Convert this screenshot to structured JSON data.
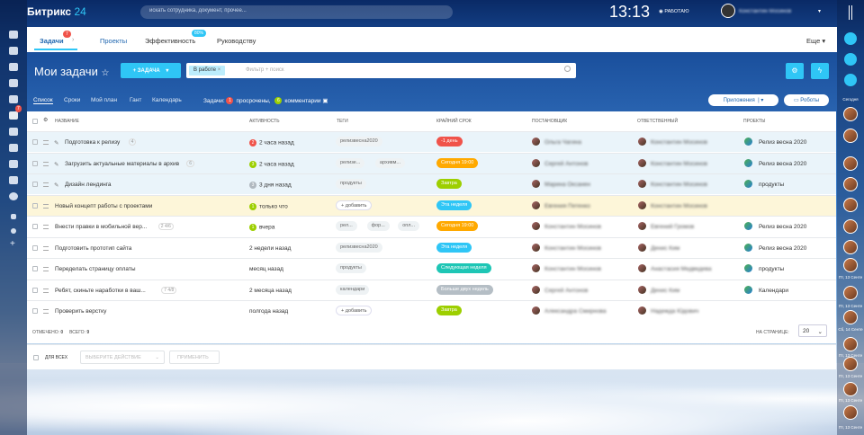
{
  "app": {
    "logo_a": "Битрикс",
    "logo_b": "24",
    "search_placeholder": "искать сотрудника, документ, прочее...",
    "clock": "13:13",
    "work_status": "РАБОТАЮ",
    "user_name": "Константин Мосинов"
  },
  "sidebar": {
    "badge": "7"
  },
  "right": {
    "today": "Сегодня",
    "d1": "Пт, 13 Сенте",
    "d2": "Пт, 13 Сенте",
    "d3": "Пт, 13 Сенте",
    "d4": "Сб, 14 Сенте",
    "d5": "Пт, 13 Сенте",
    "d6": "Пт, 13 Сенте",
    "d7": "Пт, 13 Сенте"
  },
  "nav": {
    "tasks": "Задачи",
    "tasks_badge": "7",
    "projects": "Проекты",
    "efficiency": "Эффективность",
    "eff_badge": "80%",
    "leadership": "Руководству",
    "more": "Еще"
  },
  "header": {
    "title": "Мои задачи",
    "add_button": "+ ЗАДАЧА",
    "filter_chip": "В работе",
    "filter_placeholder": "Фильтр + поиск"
  },
  "views": {
    "list": "Список",
    "deadlines": "Сроки",
    "plan": "Мой план",
    "gantt": "Гант",
    "calendar": "Календарь",
    "tasks_label": "Задачи:",
    "overdue_count": "1",
    "overdue": "просрочены,",
    "comments_count": "6",
    "comments": "комментарии",
    "apps": "Приложения",
    "robots": "Роботы"
  },
  "columns": {
    "name": "НАЗВАНИЕ",
    "activity": "АКТИВНОСТЬ",
    "tags": "ТЕГИ",
    "deadline": "КРАЙНИЙ СРОК",
    "creator": "ПОСТАНОВЩИК",
    "responsible": "ОТВЕТСТВЕННЫЙ",
    "projects": "ПРОЕКТЫ"
  },
  "rows": [
    {
      "name": "Подготовка к релизу",
      "meta": "4",
      "act_badge": "2",
      "act_color": "#f0534a",
      "activity": "2 часа назад",
      "tags": [
        "релизвесна2020"
      ],
      "deadline": "-1 день",
      "dl_color": "#f0534a",
      "creator": "Ольга Чагина",
      "resp": "Константин Мосинов",
      "project": "Релиз весна 2020",
      "style": "b",
      "pin": true
    },
    {
      "name": "Загрузить актуальные материалы в архив",
      "meta": "6",
      "act_badge": "3",
      "act_color": "#9dcf00",
      "activity": "2 часа назад",
      "tags": [
        "релизе...",
        "архивм..."
      ],
      "deadline": "Сегодня 19:00",
      "dl_color": "#ffa900",
      "creator": "Сергей Антонов",
      "resp": "Константин Мосинов",
      "project": "Релиз весна 2020",
      "style": "b",
      "pin": true
    },
    {
      "name": "Дизайн лендинга",
      "meta": "",
      "act_badge": "3",
      "act_color": "#b0b8bf",
      "activity": "3 дня назад",
      "tags": [
        "продукты"
      ],
      "deadline": "Завтра",
      "dl_color": "#9dcf00",
      "creator": "Марина Оксанен",
      "resp": "Константин Мосинов",
      "project": "продукты",
      "style": "b",
      "pin": true
    },
    {
      "name": "Новый концепт работы с проектами",
      "meta": "",
      "act_badge": "1",
      "act_color": "#9dcf00",
      "activity": "только что",
      "tags": [
        "+ добавить"
      ],
      "deadline": "Эта неделя",
      "dl_color": "#2fc6f6",
      "creator": "Евгения Петенко",
      "resp": "Константин Мосинов",
      "project": "",
      "style": "y",
      "pin": false
    },
    {
      "name": "Внести правки в мобильной вер...",
      "meta": "2  4/6",
      "act_badge": "1",
      "act_color": "#9dcf00",
      "activity": "вчера",
      "tags": [
        "рел...",
        "фор...",
        "опл..."
      ],
      "deadline": "Сегодня 19:00",
      "dl_color": "#ffa900",
      "creator": "Константин Мосинов",
      "resp": "Евгений Громов",
      "project": "Релиз весна 2020",
      "style": "",
      "pin": false
    },
    {
      "name": "Подготовить прототип сайта",
      "meta": "",
      "act_badge": "",
      "act_color": "",
      "activity": "2 недели назад",
      "tags": [
        "релизвесна2020"
      ],
      "deadline": "Эта неделя",
      "dl_color": "#2fc6f6",
      "creator": "Константин Мосинов",
      "resp": "Денис Ким",
      "project": "Релиз весна 2020",
      "style": "",
      "pin": false
    },
    {
      "name": "Переделать страницу оплаты",
      "meta": "",
      "act_badge": "",
      "act_color": "",
      "activity": "месяц назад",
      "tags": [
        "продукты"
      ],
      "deadline": "Следующая неделя",
      "dl_color": "#1ec6b5",
      "creator": "Константин Мосинов",
      "resp": "Анастасия Медведева",
      "project": "продукты",
      "style": "",
      "pin": false
    },
    {
      "name": "Ребят, скиньте наработки в ваш...",
      "meta": "7  4/8",
      "act_badge": "",
      "act_color": "",
      "activity": "2 месяца назад",
      "tags": [
        "календари"
      ],
      "deadline": "Больше двух недель",
      "dl_color": "#b5bec5",
      "creator": "Сергей Антонов",
      "resp": "Денис Ким",
      "project": "Календари",
      "style": "",
      "pin": false
    },
    {
      "name": "Проверить верстку",
      "meta": "",
      "act_badge": "",
      "act_color": "",
      "activity": "полгода назад",
      "tags": [
        "+ добавить"
      ],
      "deadline": "Завтра",
      "dl_color": "#9dcf00",
      "creator": "Александра Смирнова",
      "resp": "Надежда Юдович",
      "project": "",
      "style": "",
      "pin": false
    }
  ],
  "summary": {
    "marked_label": "ОТМЕЧЕНО:",
    "marked": "0",
    "total_label": "ВСЕГО:",
    "total": "9",
    "per_page_label": "НА СТРАНИЦЕ:",
    "per_page": "20"
  },
  "footer": {
    "for_all": "ДЛЯ ВСЕХ",
    "choose_action": "ВЫБЕРИТЕ ДЕЙСТВИЕ",
    "apply": "ПРИМЕНИТЬ"
  }
}
